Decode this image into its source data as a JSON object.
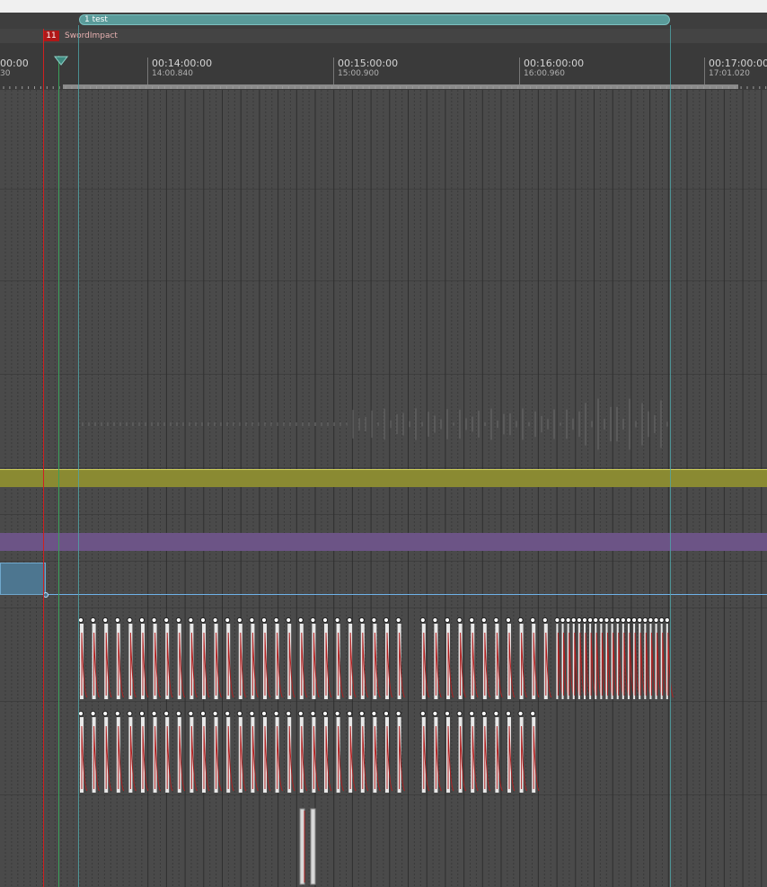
{
  "region": {
    "label": "1 test"
  },
  "marker": {
    "number": "11",
    "name": "SwordImpact"
  },
  "ruler": {
    "left_partial": {
      "time": "00:00",
      "sub": "30"
    },
    "ticks": [
      {
        "time": "00:14:00:00",
        "sub": "14:00.840"
      },
      {
        "time": "00:15:00:00",
        "sub": "15:00.900"
      },
      {
        "time": "00:16:00:00",
        "sub": "16:00.960"
      },
      {
        "time": "00:17:00:00",
        "sub": "17:01.020"
      }
    ]
  },
  "colors": {
    "region": "#5a9b9a",
    "marker": "#b01818",
    "playhead": "#d02020",
    "cursor": "#3aa05a",
    "yellow_track": "#8a8a32",
    "purple_track": "#6c5486",
    "automation": "#6fb2e8",
    "event_fill": "#ececec",
    "event_curve": "#b02020"
  },
  "icons": {
    "playhead_head": "triangle-down-icon",
    "event_handle": "circle-handle-icon"
  }
}
